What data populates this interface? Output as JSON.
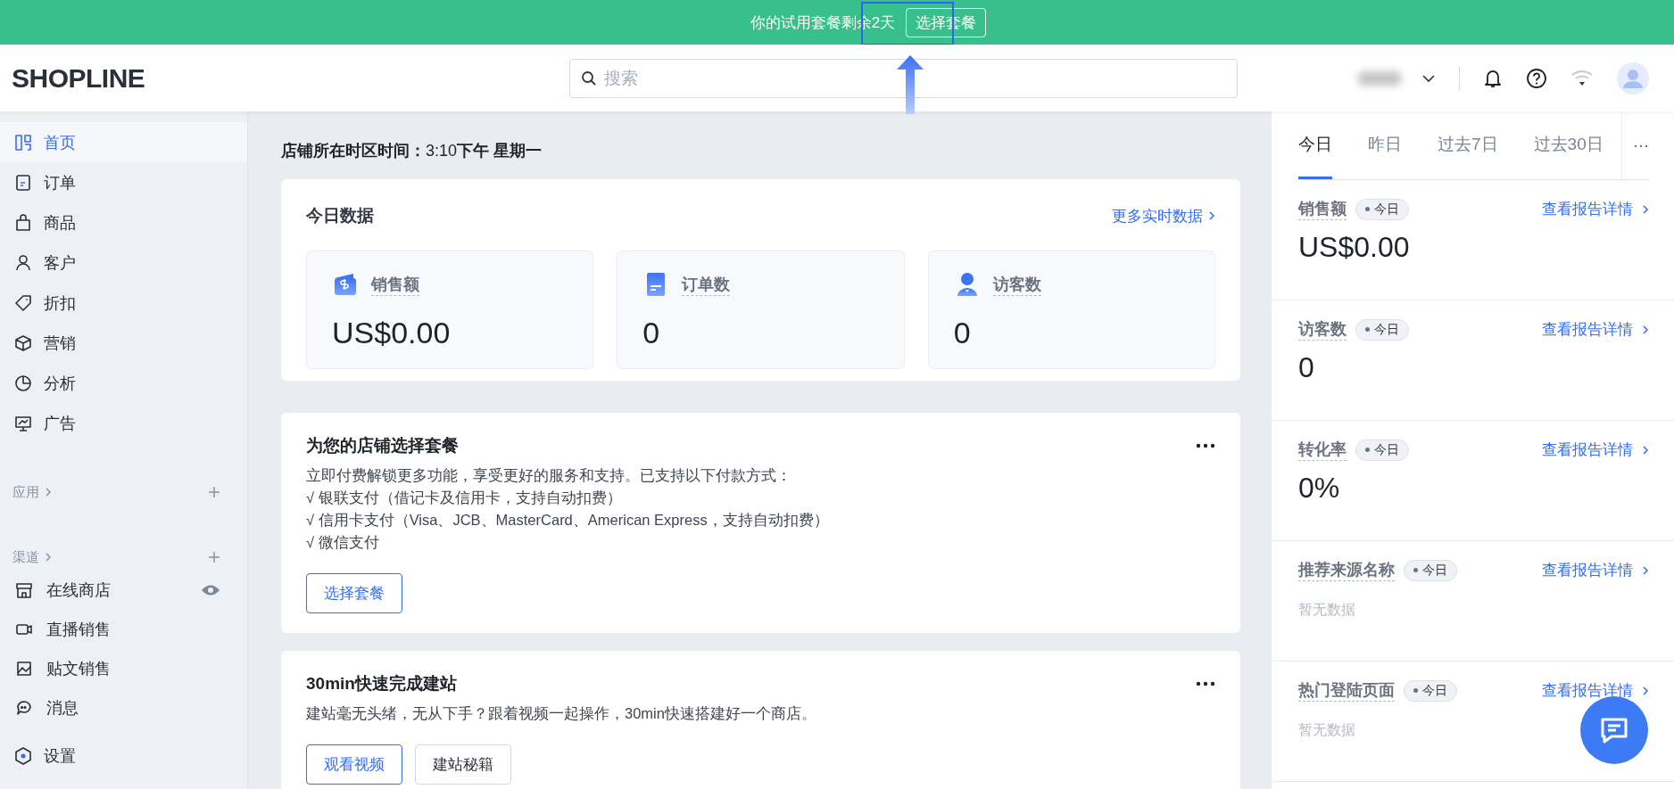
{
  "banner": {
    "text": "你的试用套餐剩余2天",
    "button": "选择套餐",
    "highlighted": true
  },
  "header": {
    "logo": "SHOPLINE",
    "search": {
      "placeholder": "搜索"
    }
  },
  "sidebar": {
    "items": [
      {
        "label": "首页",
        "selected": true
      },
      {
        "label": "订单",
        "selected": false
      },
      {
        "label": "商品",
        "selected": false
      },
      {
        "label": "客户",
        "selected": false
      },
      {
        "label": "折扣",
        "selected": false
      },
      {
        "label": "营销",
        "selected": false
      },
      {
        "label": "分析",
        "selected": false
      },
      {
        "label": "广告",
        "selected": false
      }
    ],
    "sections": [
      {
        "title": "应用"
      },
      {
        "title": "渠道",
        "items": [
          {
            "label": "在线商店",
            "selected": false,
            "visible": true
          },
          {
            "label": "直播销售",
            "selected": false
          },
          {
            "label": "贴文销售",
            "selected": false
          },
          {
            "label": "消息",
            "selected": false
          }
        ]
      }
    ],
    "settings": {
      "label": "设置",
      "selected": false
    }
  },
  "main": {
    "time": "**店铺所在时区时间：**3:10**下午 星期一**",
    "today": {
      "title": "今日数据",
      "link": "更多实时数据",
      "metrics": [
        {
          "label": "销售额",
          "value": "US$0.00"
        },
        {
          "label": "订单数",
          "value": "0"
        },
        {
          "label": "访客数",
          "value": "0"
        }
      ]
    },
    "cards": [
      {
        "title": "为您的店铺选择套餐",
        "lines": [
          "立即付费解锁更多功能，享受更好的服务和支持。已支持以下付款方式：",
          "√ 银联支付（借记卡及信用卡，支持自动扣费）",
          "√ 信用卡支付（Visa、JCB、MasterCard、American Express，支持自动扣费）",
          "√ 微信支付"
        ],
        "buttons": [
          {
            "label": "选择套餐",
            "primary": true
          }
        ]
      },
      {
        "title": "30min快速完成建站",
        "lines": [
          "建站毫无头绪，无从下手？跟着视频一起操作，30min快速搭建好一个商店。"
        ],
        "buttons": [
          {
            "label": "观看视频",
            "primary": true
          },
          {
            "label": "建站秘籍",
            "primary": false
          }
        ]
      }
    ]
  },
  "report": {
    "tabs": [
      {
        "label": "今日",
        "selected": true
      },
      {
        "label": "昨日",
        "selected": false
      },
      {
        "label": "过去7日",
        "selected": false
      },
      {
        "label": "过去30日",
        "selected": false
      }
    ],
    "more": "···",
    "stats": [
      {
        "label": "销售额",
        "badge": "今日",
        "link": "查看报告详情",
        "value": "US$0.00",
        "kind": "value"
      },
      {
        "label": "访客数",
        "badge": "今日",
        "link": "查看报告详情",
        "value": "0",
        "kind": "value"
      },
      {
        "label": "转化率",
        "badge": "今日",
        "link": "查看报告详情",
        "value": "0%",
        "kind": "value"
      },
      {
        "label": "推荐来源名称",
        "badge": "今日",
        "link": "查看报告详情",
        "value": "暂无数据",
        "kind": "empty"
      },
      {
        "label": "热门登陆页面",
        "badge": "今日",
        "link": "查看报告详情",
        "value": "暂无数据",
        "kind": "empty"
      }
    ]
  }
}
